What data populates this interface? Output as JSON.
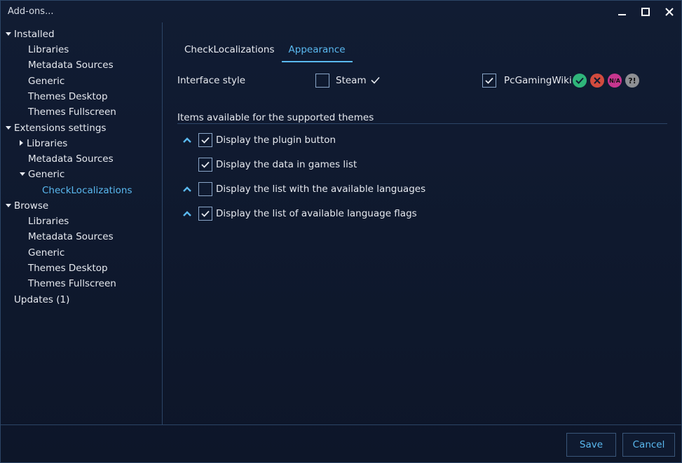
{
  "window": {
    "title": "Add-ons..."
  },
  "sidebar": {
    "installed": "Installed",
    "installed_items": [
      "Libraries",
      "Metadata Sources",
      "Generic",
      "Themes Desktop",
      "Themes Fullscreen"
    ],
    "extensions_settings": "Extensions settings",
    "ext_libraries": "Libraries",
    "ext_metadata": "Metadata Sources",
    "ext_generic": "Generic",
    "ext_checkloc": "CheckLocalizations",
    "browse": "Browse",
    "browse_items": [
      "Libraries",
      "Metadata Sources",
      "Generic",
      "Themes Desktop",
      "Themes Fullscreen"
    ],
    "updates": "Updates (1)"
  },
  "tabs": [
    "CheckLocalizations",
    "Appearance"
  ],
  "interface_style": {
    "label": "Interface style",
    "steam_label": "Steam",
    "steam_checked": false,
    "pcgw_label": "PcGamingWiki",
    "pcgw_checked": true,
    "badges": [
      {
        "icon": "check-circle-icon",
        "color": "#2fb57a"
      },
      {
        "icon": "x-circle-icon",
        "color": "#d24b3e"
      },
      {
        "icon": "na-circle-icon",
        "color": "#c7368f",
        "text": "N/A"
      },
      {
        "icon": "question-circle-icon",
        "color": "#8d8f93",
        "text": "?!"
      }
    ]
  },
  "section": {
    "title": "Items available for the supported themes"
  },
  "items": [
    {
      "label": "Display the plugin button",
      "checked": true,
      "has_caret": true
    },
    {
      "label": "Display the data in games list",
      "checked": true,
      "has_caret": false
    },
    {
      "label": "Display the list with the available languages",
      "checked": false,
      "has_caret": true
    },
    {
      "label": "Display the list of available language flags",
      "checked": true,
      "has_caret": true
    }
  ],
  "footer": {
    "save": "Save",
    "cancel": "Cancel"
  },
  "colors": {
    "accent": "#5ab9f0",
    "border": "#2c4566",
    "background": "#0f1a30"
  }
}
